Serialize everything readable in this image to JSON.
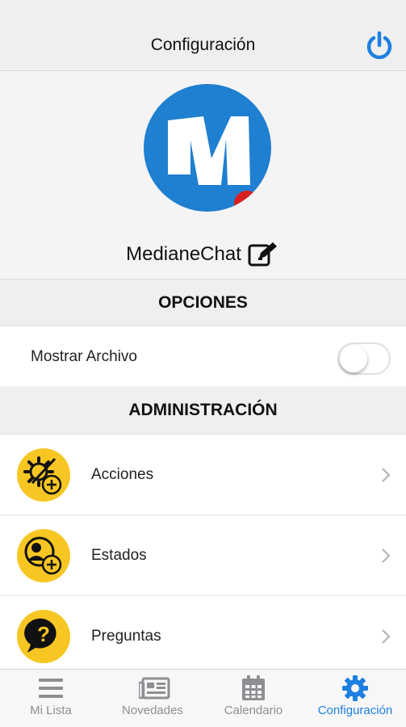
{
  "header": {
    "title": "Configuración",
    "power_icon": "power-icon",
    "accent": "#1f7fe0"
  },
  "profile": {
    "name": "MedianeChat",
    "edit_icon": "edit-icon"
  },
  "options_section": {
    "title": "OPCIONES",
    "toggle": {
      "label": "Mostrar Archivo",
      "on": false
    }
  },
  "admin_section": {
    "title": "ADMINISTRACIÓN",
    "items": [
      {
        "label": "Acciones",
        "icon": "gear-plus-icon"
      },
      {
        "label": "Estados",
        "icon": "users-plus-icon"
      },
      {
        "label": "Preguntas",
        "icon": "question-icon"
      }
    ],
    "icon_color": "#f7c623"
  },
  "tabbar": {
    "tabs": [
      {
        "label": "Mi Lista",
        "icon": "list-icon",
        "active": false
      },
      {
        "label": "Novedades",
        "icon": "news-icon",
        "active": false
      },
      {
        "label": "Calendario",
        "icon": "calendar-icon",
        "active": false
      },
      {
        "label": "Configuración",
        "icon": "gear-icon",
        "active": true
      }
    ],
    "active_color": "#1f7fe0",
    "inactive_color": "#8e8e93"
  }
}
